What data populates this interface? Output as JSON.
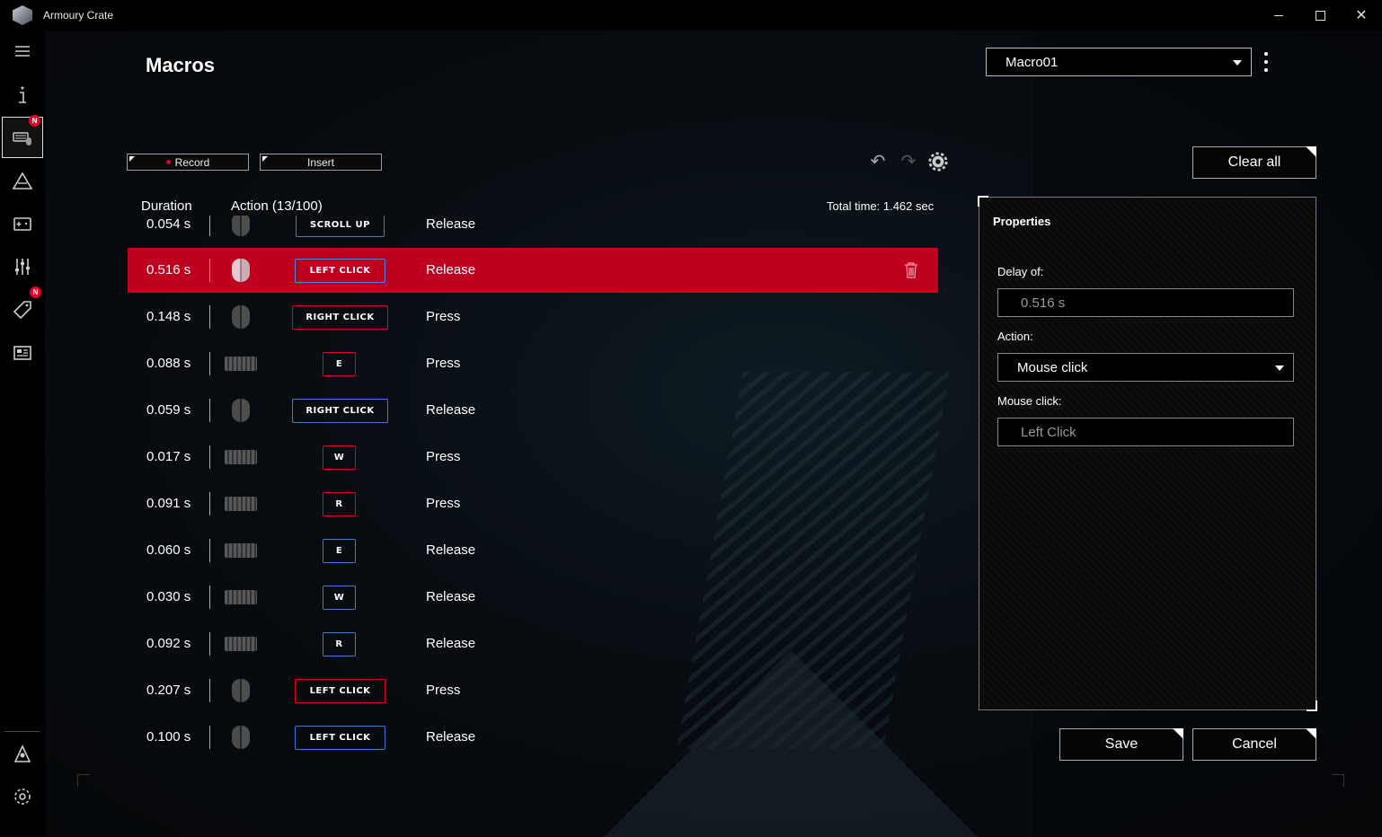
{
  "window": {
    "title": "Armoury Crate"
  },
  "header": {
    "page_title": "Macros",
    "profile_selected": "Macro01"
  },
  "toolbar": {
    "record_label": "Record",
    "insert_label": "Insert",
    "clear_all_label": "Clear all"
  },
  "table": {
    "col_duration": "Duration",
    "col_action": "Action (13/100)",
    "total_time": "Total time: 1.462 sec",
    "rows": [
      {
        "duration": "0.054 s",
        "device": "mouse",
        "key": "SCROLL UP",
        "state": "Release",
        "selected": false
      },
      {
        "duration": "0.516 s",
        "device": "mouse",
        "key": "LEFT CLICK",
        "state": "Release",
        "selected": true
      },
      {
        "duration": "0.148 s",
        "device": "mouse",
        "key": "RIGHT CLICK",
        "state": "Press",
        "selected": false
      },
      {
        "duration": "0.088 s",
        "device": "keyboard",
        "key": "E",
        "state": "Press",
        "selected": false
      },
      {
        "duration": "0.059 s",
        "device": "mouse",
        "key": "RIGHT CLICK",
        "state": "Release",
        "selected": false
      },
      {
        "duration": "0.017 s",
        "device": "keyboard",
        "key": "W",
        "state": "Press",
        "selected": false
      },
      {
        "duration": "0.091 s",
        "device": "keyboard",
        "key": "R",
        "state": "Press",
        "selected": false
      },
      {
        "duration": "0.060 s",
        "device": "keyboard",
        "key": "E",
        "state": "Release",
        "selected": false
      },
      {
        "duration": "0.030 s",
        "device": "keyboard",
        "key": "W",
        "state": "Release",
        "selected": false
      },
      {
        "duration": "0.092 s",
        "device": "keyboard",
        "key": "R",
        "state": "Release",
        "selected": false
      },
      {
        "duration": "0.207 s",
        "device": "mouse",
        "key": "LEFT CLICK",
        "state": "Press",
        "selected": false
      },
      {
        "duration": "0.100 s",
        "device": "mouse",
        "key": "LEFT CLICK",
        "state": "Release",
        "selected": false
      }
    ]
  },
  "properties": {
    "title": "Properties",
    "delay_label": "Delay of:",
    "delay_value": "0.516 s",
    "action_label": "Action:",
    "action_value": "Mouse click",
    "mouse_click_label": "Mouse click:",
    "mouse_click_value": "Left Click"
  },
  "footer": {
    "save_label": "Save",
    "cancel_label": "Cancel"
  },
  "sidebar": {
    "items": [
      {
        "icon": "menu-icon"
      },
      {
        "icon": "info-icon"
      },
      {
        "icon": "device-icon",
        "badge": "N",
        "active": true
      },
      {
        "icon": "aura-icon"
      },
      {
        "icon": "game-library-icon"
      },
      {
        "icon": "equalizer-icon"
      },
      {
        "icon": "deals-icon",
        "badge": "N"
      },
      {
        "icon": "news-icon"
      },
      {
        "icon": "user-center-icon"
      },
      {
        "icon": "settings-icon"
      }
    ]
  },
  "colors": {
    "accent_red": "#c0001f",
    "press_border": "#e4002b",
    "release_border": "#3a7bd5"
  }
}
